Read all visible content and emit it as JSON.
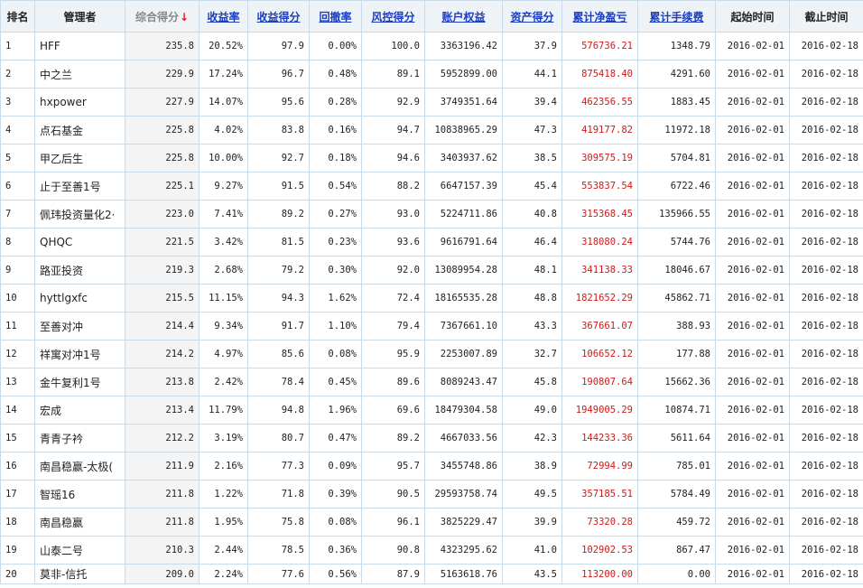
{
  "headers": [
    {
      "key": "rank",
      "label": "排名",
      "link": false
    },
    {
      "key": "manager",
      "label": "管理者",
      "link": false
    },
    {
      "key": "total_score",
      "label": "综合得分",
      "link": false,
      "sorted": true,
      "sort_arrow": "↓"
    },
    {
      "key": "return_rate",
      "label": "收益率",
      "link": true
    },
    {
      "key": "return_score",
      "label": "收益得分",
      "link": true
    },
    {
      "key": "drawdown",
      "label": "回撤率",
      "link": true
    },
    {
      "key": "risk_score",
      "label": "风控得分",
      "link": true
    },
    {
      "key": "equity",
      "label": "账户权益",
      "link": true
    },
    {
      "key": "asset_score",
      "label": "资产得分",
      "link": true
    },
    {
      "key": "cum_pnl",
      "label": "累计净盈亏",
      "link": true
    },
    {
      "key": "cum_fee",
      "label": "累计手续费",
      "link": true
    },
    {
      "key": "start",
      "label": "起始时间",
      "link": false
    },
    {
      "key": "end",
      "label": "截止时间",
      "link": false
    }
  ],
  "rows": [
    [
      "1",
      "HFF",
      "235.8",
      "20.52%",
      "97.9",
      "0.00%",
      "100.0",
      "3363196.42",
      "37.9",
      "576736.21",
      "1348.79",
      "2016-02-01",
      "2016-02-18"
    ],
    [
      "2",
      "中之兰",
      "229.9",
      "17.24%",
      "96.7",
      "0.48%",
      "89.1",
      "5952899.00",
      "44.1",
      "875418.40",
      "4291.60",
      "2016-02-01",
      "2016-02-18"
    ],
    [
      "3",
      "hxpower",
      "227.9",
      "14.07%",
      "95.6",
      "0.28%",
      "92.9",
      "3749351.64",
      "39.4",
      "462356.55",
      "1883.45",
      "2016-02-01",
      "2016-02-18"
    ],
    [
      "4",
      "点石基金",
      "225.8",
      "4.02%",
      "83.8",
      "0.16%",
      "94.7",
      "10838965.29",
      "47.3",
      "419177.82",
      "11972.18",
      "2016-02-01",
      "2016-02-18"
    ],
    [
      "5",
      "甲乙后生",
      "225.8",
      "10.00%",
      "92.7",
      "0.18%",
      "94.6",
      "3403937.62",
      "38.5",
      "309575.19",
      "5704.81",
      "2016-02-01",
      "2016-02-18"
    ],
    [
      "6",
      "止于至善1号",
      "225.1",
      "9.27%",
      "91.5",
      "0.54%",
      "88.2",
      "6647157.39",
      "45.4",
      "553837.54",
      "6722.46",
      "2016-02-01",
      "2016-02-18"
    ],
    [
      "7",
      "佩玮投资量化2·",
      "223.0",
      "7.41%",
      "89.2",
      "0.27%",
      "93.0",
      "5224711.86",
      "40.8",
      "315368.45",
      "135966.55",
      "2016-02-01",
      "2016-02-18"
    ],
    [
      "8",
      "QHQC",
      "221.5",
      "3.42%",
      "81.5",
      "0.23%",
      "93.6",
      "9616791.64",
      "46.4",
      "318080.24",
      "5744.76",
      "2016-02-01",
      "2016-02-18"
    ],
    [
      "9",
      "路亚投资",
      "219.3",
      "2.68%",
      "79.2",
      "0.30%",
      "92.0",
      "13089954.28",
      "48.1",
      "341138.33",
      "18046.67",
      "2016-02-01",
      "2016-02-18"
    ],
    [
      "10",
      "hyttlgxfc",
      "215.5",
      "11.15%",
      "94.3",
      "1.62%",
      "72.4",
      "18165535.28",
      "48.8",
      "1821652.29",
      "45862.71",
      "2016-02-01",
      "2016-02-18"
    ],
    [
      "11",
      "至善对冲",
      "214.4",
      "9.34%",
      "91.7",
      "1.10%",
      "79.4",
      "7367661.10",
      "43.3",
      "367661.07",
      "388.93",
      "2016-02-01",
      "2016-02-18"
    ],
    [
      "12",
      "祥寓对冲1号",
      "214.2",
      "4.97%",
      "85.6",
      "0.08%",
      "95.9",
      "2253007.89",
      "32.7",
      "106652.12",
      "177.88",
      "2016-02-01",
      "2016-02-18"
    ],
    [
      "13",
      "金牛复利1号",
      "213.8",
      "2.42%",
      "78.4",
      "0.45%",
      "89.6",
      "8089243.47",
      "45.8",
      "190807.64",
      "15662.36",
      "2016-02-01",
      "2016-02-18"
    ],
    [
      "14",
      "宏成",
      "213.4",
      "11.79%",
      "94.8",
      "1.96%",
      "69.6",
      "18479304.58",
      "49.0",
      "1949005.29",
      "10874.71",
      "2016-02-01",
      "2016-02-18"
    ],
    [
      "15",
      "青青子衿",
      "212.2",
      "3.19%",
      "80.7",
      "0.47%",
      "89.2",
      "4667033.56",
      "42.3",
      "144233.36",
      "5611.64",
      "2016-02-01",
      "2016-02-18"
    ],
    [
      "16",
      "南昌稳赢-太极(",
      "211.9",
      "2.16%",
      "77.3",
      "0.09%",
      "95.7",
      "3455748.86",
      "38.9",
      "72994.99",
      "785.01",
      "2016-02-01",
      "2016-02-18"
    ],
    [
      "17",
      "智瑶16",
      "211.8",
      "1.22%",
      "71.8",
      "0.39%",
      "90.5",
      "29593758.74",
      "49.5",
      "357185.51",
      "5784.49",
      "2016-02-01",
      "2016-02-18"
    ],
    [
      "18",
      "南昌稳赢",
      "211.8",
      "1.95%",
      "75.8",
      "0.08%",
      "96.1",
      "3825229.47",
      "39.9",
      "73320.28",
      "459.72",
      "2016-02-01",
      "2016-02-18"
    ],
    [
      "19",
      "山泰二号",
      "210.3",
      "2.44%",
      "78.5",
      "0.36%",
      "90.8",
      "4323295.62",
      "41.0",
      "102902.53",
      "867.47",
      "2016-02-01",
      "2016-02-18"
    ],
    [
      "20",
      "莫非-信托",
      "209.0",
      "2.24%",
      "77.6",
      "0.56%",
      "87.9",
      "5163618.76",
      "43.5",
      "113200.00",
      "0.00",
      "2016-02-01",
      "2016-02-18"
    ]
  ],
  "colors": {
    "link": "#1a3dc1",
    "sorted_header": "#888888",
    "sort_arrow": "#e02020",
    "pnl": "#d01818",
    "border": "#c9dbe9",
    "header_bg": "#eef3f8"
  }
}
